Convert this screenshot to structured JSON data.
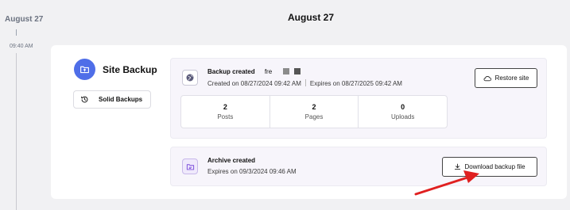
{
  "timeline": {
    "date": "August 27",
    "time": "09:40 AM"
  },
  "header": {
    "date": "August 27"
  },
  "site": {
    "title": "Site Backup",
    "tag_label": "Solid Backups"
  },
  "backup": {
    "title": "Backup created",
    "site_name": "fre",
    "created": "Created on 08/27/2024 09:42 AM",
    "expires": "Expires on 08/27/2025 09:42 AM",
    "restore_label": "Restore site",
    "stats": [
      {
        "value": "2",
        "label": "Posts"
      },
      {
        "value": "2",
        "label": "Pages"
      },
      {
        "value": "0",
        "label": "Uploads"
      }
    ]
  },
  "archive": {
    "title": "Archive created",
    "expires": "Expires on 09/3/2024 09:46 AM",
    "download_label": "Download backup file"
  },
  "colors": {
    "accent": "#4f6ee8",
    "annotation_arrow": "#e02020"
  }
}
